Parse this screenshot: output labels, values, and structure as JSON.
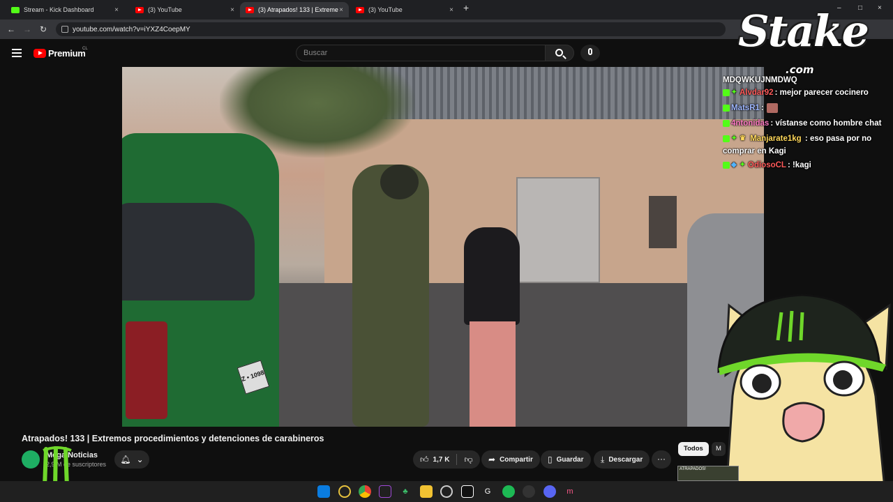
{
  "browser": {
    "tabs": [
      {
        "title": "Stream - Kick Dashboard",
        "active": false,
        "favicon": "kick-icon"
      },
      {
        "title": "(3) YouTube",
        "active": false,
        "favicon": "youtube-icon"
      },
      {
        "title": "(3) Atrapados! 133 | Extreme",
        "active": true,
        "favicon": "youtube-icon"
      },
      {
        "title": "(3) YouTube",
        "active": false,
        "favicon": "youtube-icon"
      }
    ],
    "new_tab": "+",
    "close_glyph": "×",
    "url": "youtube.com/watch?v=iYXZ4CoepMY",
    "window_controls": {
      "minimize": "–",
      "maximize": "□",
      "close": "×"
    }
  },
  "youtube": {
    "logo_text": "Premium",
    "region": "CL",
    "search_placeholder": "Buscar"
  },
  "overlay": {
    "stake_logo": "Stake",
    "stake_sub": ".com",
    "chat": [
      {
        "user": "MDQWKUJNMDWQ",
        "user_color": "#ffffff",
        "message": "",
        "partial": true
      },
      {
        "user": "Alvdar92",
        "user_color": "#ff5a5a",
        "message": ": mejor parecer cocinero",
        "badges": [
          "kick-badge",
          "sparkle-badge"
        ]
      },
      {
        "user": "MatsR1",
        "user_color": "#9fb7ff",
        "message": ":",
        "badges": [
          "kick-badge"
        ],
        "emote": true
      },
      {
        "user": "4ntonidas",
        "user_color": "#ff7ac3",
        "message": ": vístanse como hombre chat",
        "badges": [
          "kick-badge"
        ]
      },
      {
        "user": "Manjarate1kg",
        "user_color": "#ffd85a",
        "message": ": eso pasa por no comprar en Kagi",
        "badges": [
          "kick-badge",
          "sparkle-badge",
          "crown-badge"
        ]
      },
      {
        "user": "OdiosoCL",
        "user_color": "#ff5a5a",
        "message": ": !kagi",
        "badges": [
          "kick-badge",
          "gem-badge",
          "sparkle-badge"
        ]
      }
    ]
  },
  "video": {
    "title": "Atrapados! 133 | Extremos procedimientos y detenciones de carabineros",
    "channel_name": "Mega Noticias",
    "channel_subs": "2,9 M de suscriptores",
    "likes": "1,7 K",
    "share_label": "Compartir",
    "save_label": "Guardar",
    "download_label": "Descargar",
    "more_label": "···",
    "car_plate": "Z • 1098"
  },
  "sidebar": {
    "chip_all": "Todos",
    "chip_next": "M",
    "thumb_text": "ATRAPADOS!"
  },
  "taskbar": {
    "icons": [
      "windows-start-icon",
      "circle-app-icon",
      "chrome-icon",
      "purple-app-icon",
      "tree-app-icon",
      "folder-icon",
      "steam-icon",
      "capcut-icon",
      "g-app-icon",
      "spotify-icon",
      "obs-icon",
      "discord-icon",
      "red-app-icon"
    ]
  }
}
